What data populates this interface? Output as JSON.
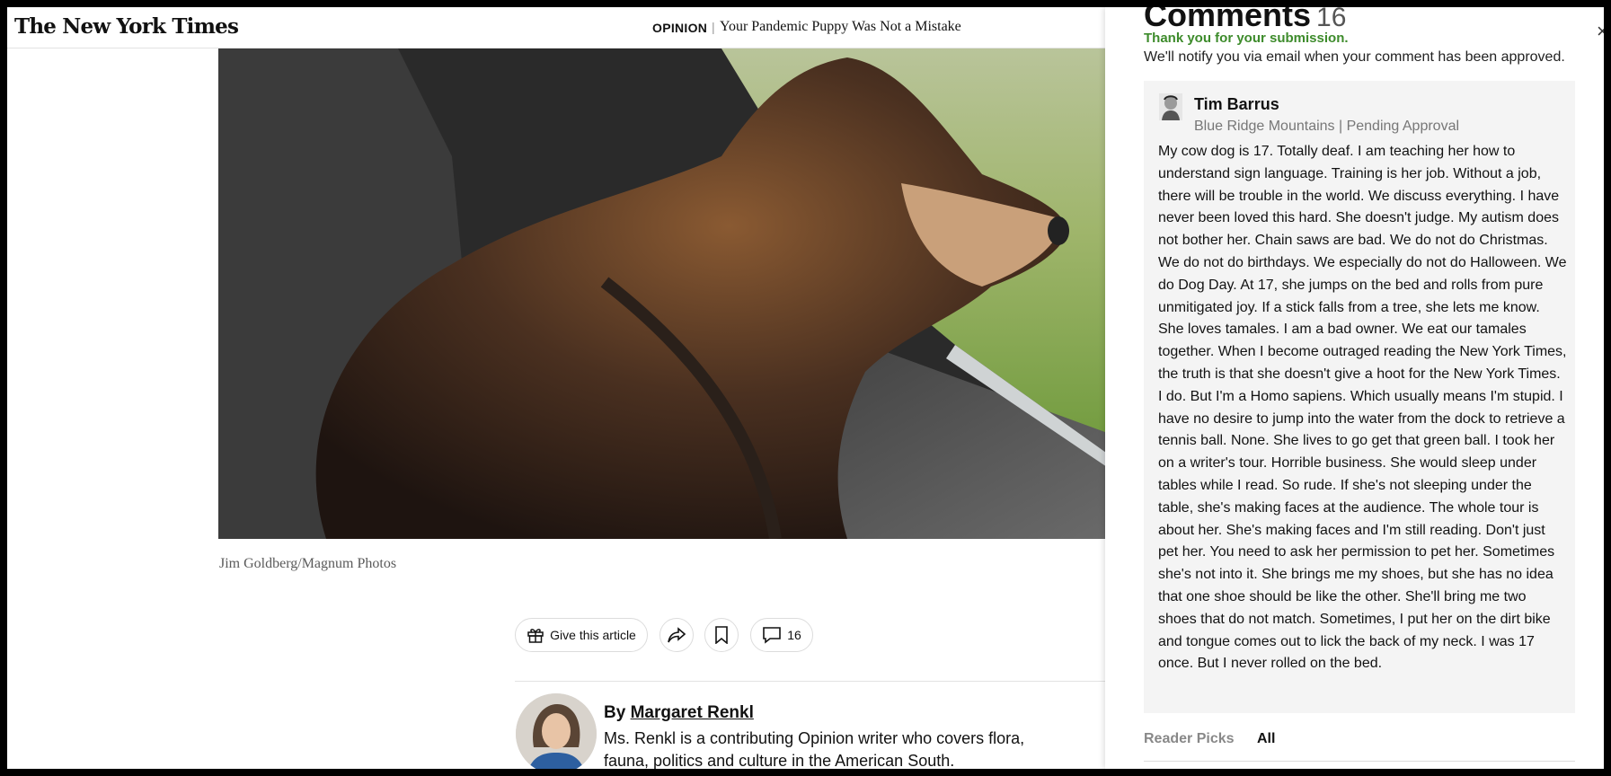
{
  "header": {
    "logo": "The New York Times",
    "section": "OPINION",
    "separator": "|",
    "headline": "Your Pandemic Puppy Was Not a Mistake"
  },
  "photo": {
    "caption": "Jim Goldberg/Magnum Photos"
  },
  "actions": {
    "gift_label": "Give this article",
    "comment_count": "16"
  },
  "byline": {
    "prefix": "By",
    "author": "Margaret Renkl",
    "bio": "Ms. Renkl is a contributing Opinion writer who covers flora, fauna, politics and culture in the American South."
  },
  "comments": {
    "title": "Comments",
    "count": "16",
    "close_glyph": "×",
    "thanks": "Thank you for your submission.",
    "notice": "We'll notify you via email when your comment has been approved.",
    "comment": {
      "name": "Tim Barrus",
      "meta": "Blue Ridge Mountains | Pending Approval",
      "body": "My cow dog is 17. Totally deaf. I am teaching her how to understand sign language. Training is her job. Without a job, there will be trouble in the world. We discuss everything. I have never been loved this hard. She doesn't judge. My autism does not bother her. Chain saws are bad. We do not do Christmas. We do not do birthdays. We especially do not do Halloween. We do Dog Day. At 17, she jumps on the bed and rolls from pure unmitigated joy. If a stick falls from a tree, she lets me know. She loves tamales. I am a bad owner. We eat our tamales together. When I become outraged reading the New York Times, the truth is that she doesn't give a hoot for the New York Times. I do. But I'm a Homo sapiens. Which usually means I'm stupid. I have no desire to jump into the water from the dock to retrieve a tennis ball. None. She lives to go get that green ball. I took her on a writer's tour. Horrible business. She would sleep under tables while I read. So rude. If she's not sleeping under the table, she's making faces at the audience. The whole tour is about her. She's making faces and I'm still reading. Don't just pet her. You need to ask her permission to pet her. Sometimes she's not into it. She brings me my shoes, but she has no idea that one shoe should be like the other. She'll bring me two shoes that do not match. Sometimes, I put her on the dirt bike and tongue comes out to lick the back of my neck. I was 17 once. But I never rolled on the bed."
    },
    "tabs": [
      "Reader Picks",
      "All"
    ]
  }
}
